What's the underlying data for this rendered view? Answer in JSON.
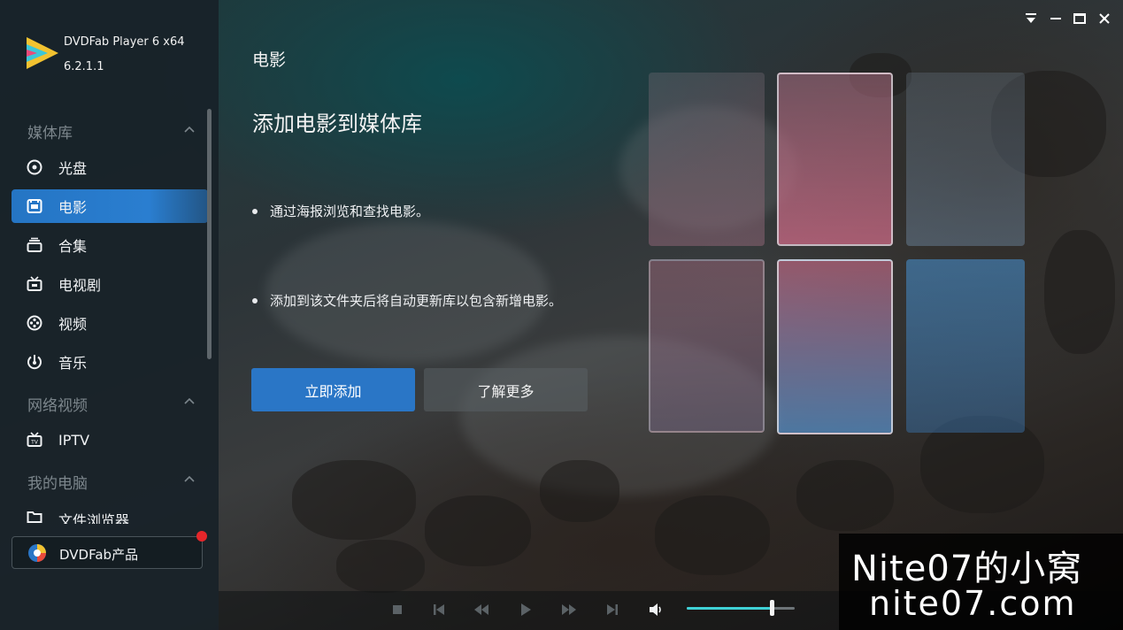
{
  "app": {
    "name": "DVDFab Player 6 x64",
    "version": "6.2.1.1"
  },
  "sidebar": {
    "sections": [
      {
        "label": "媒体库"
      },
      {
        "label": "网络视频"
      },
      {
        "label": "我的电脑"
      }
    ],
    "items": [
      {
        "label": "光盘",
        "icon": "disc-icon"
      },
      {
        "label": "电影",
        "icon": "movie-icon",
        "active": true
      },
      {
        "label": "合集",
        "icon": "collection-icon"
      },
      {
        "label": "电视剧",
        "icon": "tv-icon"
      },
      {
        "label": "视频",
        "icon": "video-reel-icon"
      },
      {
        "label": "音乐",
        "icon": "music-icon"
      },
      {
        "label": "IPTV",
        "icon": "iptv-icon"
      },
      {
        "label": "文件浏览器",
        "icon": "folder-icon"
      }
    ],
    "product_button": {
      "label": "DVDFab产品",
      "has_notification": true
    }
  },
  "main": {
    "page_title": "电影",
    "headline": "添加电影到媒体库",
    "bullets": [
      "通过海报浏览和查找电影。",
      "添加到该文件夹后将自动更新库以包含新增电影。"
    ],
    "primary_button": "立即添加",
    "secondary_button": "了解更多"
  },
  "playback": {
    "volume_level": 0.78
  },
  "watermark": {
    "line1": "Nite07的小窝",
    "line2": "nite07.com"
  },
  "colors": {
    "accent": "#2a76c6",
    "volume": "#3fd1d6",
    "notification": "#e5262a"
  }
}
